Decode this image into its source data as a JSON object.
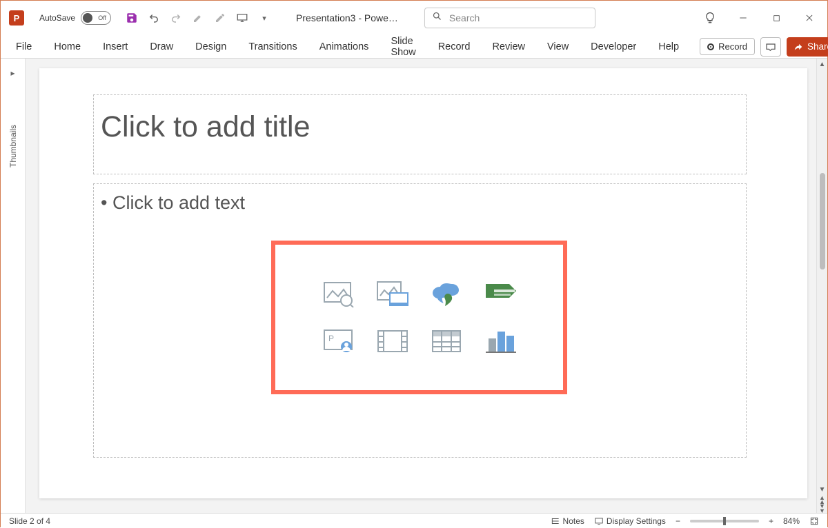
{
  "app": {
    "letter": "P",
    "autosave_label": "AutoSave",
    "autosave_state": "Off",
    "doc_title": "Presentation3 - Powe…",
    "search_placeholder": "Search"
  },
  "ribbon": {
    "tabs": [
      "File",
      "Home",
      "Insert",
      "Draw",
      "Design",
      "Transitions",
      "Animations",
      "Slide Show",
      "Record",
      "Review",
      "View",
      "Developer",
      "Help"
    ],
    "record": "Record",
    "share": "Share"
  },
  "thumbnails_label": "Thumbnails",
  "slide": {
    "title_placeholder": "Click to add title",
    "content_placeholder": "• Click to add text"
  },
  "status": {
    "slide_count": "Slide 2 of 4",
    "notes": "Notes",
    "display_settings": "Display Settings",
    "zoom": "84%"
  }
}
